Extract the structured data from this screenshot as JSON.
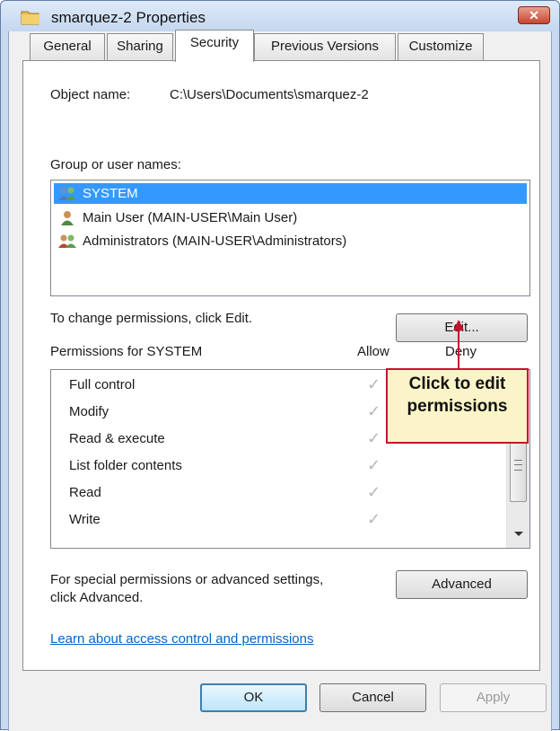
{
  "window": {
    "title": "smarquez-2 Properties",
    "close_glyph": "✕"
  },
  "tabs": [
    {
      "label": "General"
    },
    {
      "label": "Sharing"
    },
    {
      "label": "Security"
    },
    {
      "label": "Previous Versions"
    },
    {
      "label": "Customize"
    }
  ],
  "security": {
    "object_name_label": "Object name:",
    "object_name_value": "C:\\Users\\Documents\\smarquez-2",
    "group_label": "Group or user names:",
    "users": [
      {
        "name": "SYSTEM",
        "icon": "users-group-icon"
      },
      {
        "name": "Main User (MAIN-USER\\Main User)",
        "icon": "user-icon"
      },
      {
        "name": "Administrators (MAIN-USER\\Administrators)",
        "icon": "users-group-icon"
      }
    ],
    "change_text": "To change permissions, click Edit.",
    "edit_button": "Edit...",
    "permissions_label": "Permissions for SYSTEM",
    "allow_header": "Allow",
    "deny_header": "Deny",
    "permissions": [
      {
        "name": "Full control",
        "allow": "✓"
      },
      {
        "name": "Modify",
        "allow": "✓"
      },
      {
        "name": "Read & execute",
        "allow": "✓"
      },
      {
        "name": "List folder contents",
        "allow": "✓"
      },
      {
        "name": "Read",
        "allow": "✓"
      },
      {
        "name": "Write",
        "allow": "✓"
      }
    ],
    "special_text_line1": "For special permissions or advanced settings,",
    "special_text_line2": "click Advanced.",
    "advanced_button": "Advanced",
    "learn_link": "Learn about access control and permissions"
  },
  "footer": {
    "ok": "OK",
    "cancel": "Cancel",
    "apply": "Apply"
  },
  "callout": {
    "line1": "Click to edit",
    "line2": "permissions",
    "border_color": "#c8102e",
    "fill_color": "#fbf4c8"
  },
  "colors": {
    "selection": "#3399ff",
    "link": "#0066cc",
    "close_button": "#c8452e"
  }
}
